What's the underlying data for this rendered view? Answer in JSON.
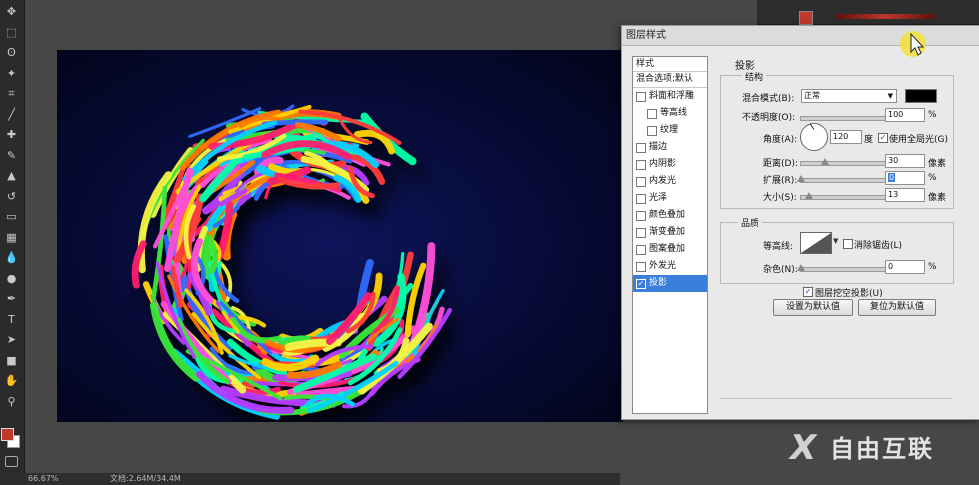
{
  "app": {
    "name": "Photoshop"
  },
  "toolbar": {
    "icons": [
      "move-icon",
      "marquee-icon",
      "lasso-icon",
      "magic-wand-icon",
      "crop-icon",
      "eyedropper-icon",
      "healing-icon",
      "brush-icon",
      "stamp-icon",
      "history-brush-icon",
      "eraser-icon",
      "gradient-icon",
      "blur-icon",
      "dodge-icon",
      "pen-icon",
      "type-icon",
      "path-select-icon",
      "shape-icon",
      "hand-icon",
      "zoom-icon"
    ]
  },
  "colors": {
    "foreground": "#c0392b",
    "background": "#ffffff",
    "canvas": "#070b36",
    "selection": "#3c7fdb"
  },
  "status": {
    "zoom": "66.67%",
    "doc": "文档:2.64M/34.4M"
  },
  "dialog": {
    "title": "图层样式",
    "styles_header": "样式",
    "blend_default": "混合选项:默认",
    "styles": [
      {
        "label": "斜面和浮雕",
        "checked": false,
        "indent": false
      },
      {
        "label": "等高线",
        "checked": false,
        "indent": true
      },
      {
        "label": "纹理",
        "checked": false,
        "indent": true
      },
      {
        "label": "描边",
        "checked": false,
        "indent": false
      },
      {
        "label": "内阴影",
        "checked": false,
        "indent": false
      },
      {
        "label": "内发光",
        "checked": false,
        "indent": false
      },
      {
        "label": "光泽",
        "checked": false,
        "indent": false
      },
      {
        "label": "颜色叠加",
        "checked": false,
        "indent": false
      },
      {
        "label": "渐变叠加",
        "checked": false,
        "indent": false
      },
      {
        "label": "图案叠加",
        "checked": false,
        "indent": false
      },
      {
        "label": "外发光",
        "checked": false,
        "indent": false
      },
      {
        "label": "投影",
        "checked": true,
        "indent": false,
        "selected": true
      }
    ],
    "section_title": "投影",
    "structure": {
      "title": "结构",
      "blend_mode_label": "混合模式(B):",
      "blend_mode_value": "正常",
      "shadow_color": "#000000",
      "opacity_label": "不透明度(O):",
      "opacity_value": "100",
      "opacity_unit": "%",
      "angle_label": "角度(A):",
      "angle_value": "120",
      "angle_unit": "度",
      "global_light_label": "使用全局光(G)",
      "global_light_checked": true,
      "distance_label": "距离(D):",
      "distance_value": "30",
      "distance_unit": "像素",
      "spread_label": "扩展(R):",
      "spread_value": "0",
      "spread_unit": "%",
      "size_label": "大小(S):",
      "size_value": "13",
      "size_unit": "像素"
    },
    "quality": {
      "title": "品质",
      "contour_label": "等高线:",
      "antialias_label": "消除锯齿(L)",
      "antialias_checked": false,
      "noise_label": "杂色(N):",
      "noise_value": "0",
      "noise_unit": "%"
    },
    "knockout_label": "图层挖空投影(U)",
    "knockout_checked": true,
    "set_default_label": "设置为默认值",
    "reset_default_label": "复位为默认值"
  },
  "watermark": {
    "text": "自由互联"
  }
}
